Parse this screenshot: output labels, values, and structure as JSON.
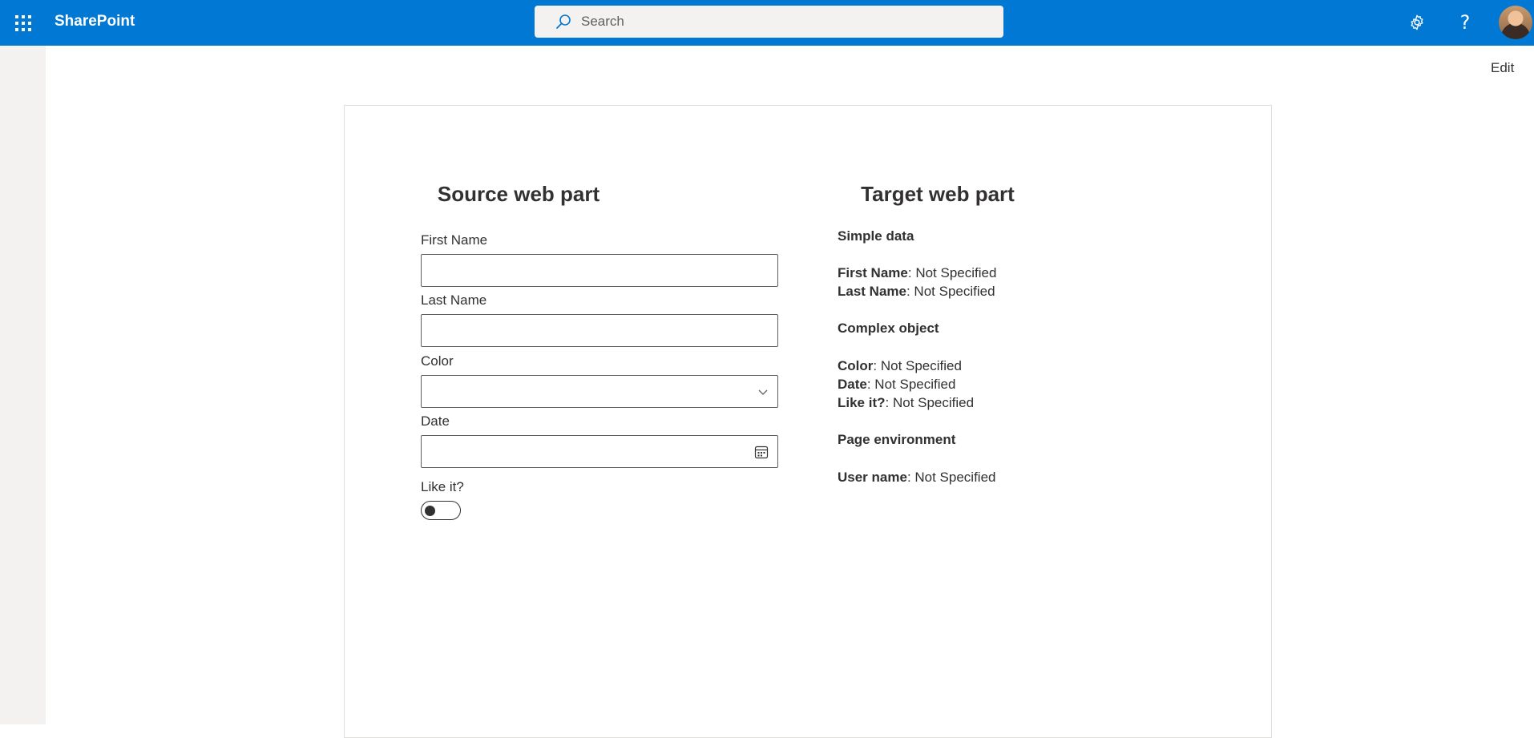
{
  "suitebar": {
    "brand": "SharePoint",
    "search_placeholder": "Search"
  },
  "page": {
    "edit_label": "Edit"
  },
  "source": {
    "title": "Source web part",
    "first_name_label": "First Name",
    "last_name_label": "Last Name",
    "color_label": "Color",
    "date_label": "Date",
    "like_label": "Like it?",
    "like_value": false
  },
  "target": {
    "title": "Target web part",
    "simple_heading": "Simple data",
    "complex_heading": "Complex object",
    "env_heading": "Page environment",
    "rows": {
      "first_name": {
        "key": "First Name",
        "value": ": Not Specified"
      },
      "last_name": {
        "key": "Last Name",
        "value": ": Not Specified"
      },
      "color": {
        "key": "Color",
        "value": ": Not Specified"
      },
      "date": {
        "key": "Date",
        "value": ": Not Specified"
      },
      "like": {
        "key": "Like it?",
        "value": ": Not Specified"
      },
      "user_name": {
        "key": "User name",
        "value": ": Not Specified"
      }
    }
  },
  "icons": {
    "waffle": "app-launcher-icon",
    "search": "search-icon",
    "settings": "gear-icon",
    "help": "help-icon",
    "dropdown": "chevron-down-icon",
    "calendar": "calendar-icon"
  },
  "colors": {
    "suitebar": "#0078d4",
    "rail": "#f3f2f1",
    "text": "#323130"
  }
}
